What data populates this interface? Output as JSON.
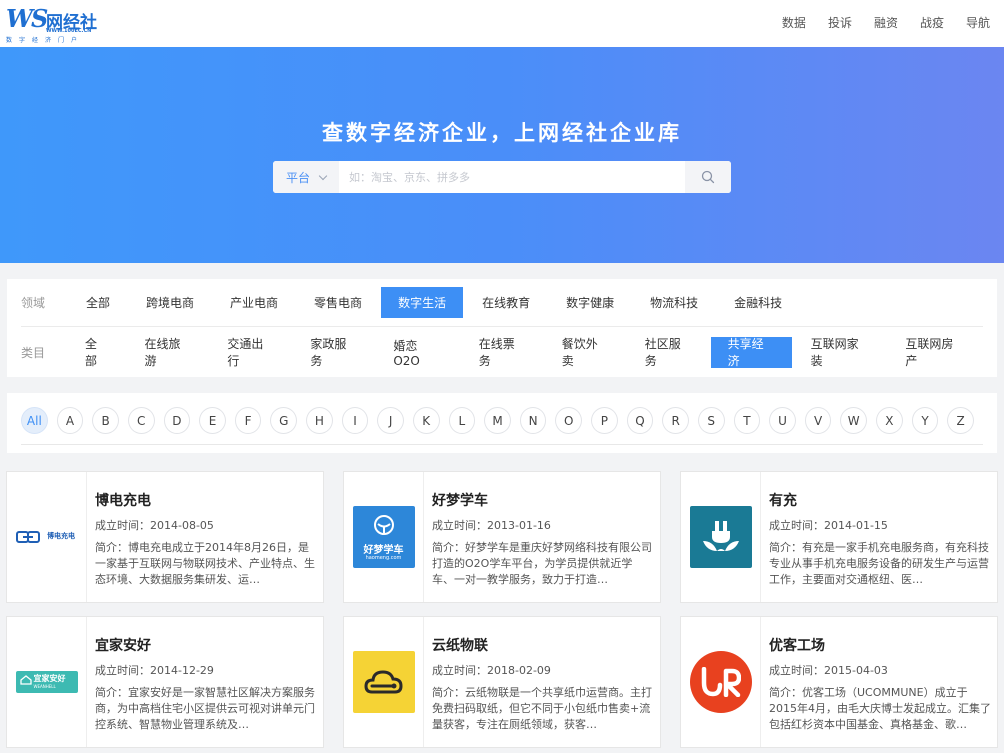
{
  "header": {
    "logo_mark": "WS",
    "logo_name": "网经社",
    "logo_url": "WWW.100EC.CN",
    "logo_tagline": "数字经济门户",
    "nav": [
      "数据",
      "投诉",
      "融资",
      "战疫",
      "导航"
    ]
  },
  "banner": {
    "title": "查数字经济企业，上网经社企业库",
    "search_category": "平台",
    "search_placeholder": "如：淘宝、京东、拼多多"
  },
  "filters": {
    "domain_label": "领域",
    "domains": [
      "全部",
      "跨境电商",
      "产业电商",
      "零售电商",
      "数字生活",
      "在线教育",
      "数字健康",
      "物流科技",
      "金融科技"
    ],
    "domain_active": 4,
    "category_label": "类目",
    "categories": [
      "全部",
      "在线旅游",
      "交通出行",
      "家政服务",
      "婚恋O2O",
      "在线票务",
      "餐饮外卖",
      "社区服务",
      "共享经济",
      "互联网家装",
      "互联网房产"
    ],
    "category_active": 8
  },
  "alphabet": {
    "letters": [
      "All",
      "A",
      "B",
      "C",
      "D",
      "E",
      "F",
      "G",
      "H",
      "I",
      "J",
      "K",
      "L",
      "M",
      "N",
      "O",
      "P",
      "Q",
      "R",
      "S",
      "T",
      "U",
      "V",
      "W",
      "X",
      "Y",
      "Z"
    ],
    "active": 0
  },
  "companies": [
    {
      "name": "博电充电",
      "founded": "成立时间：2014-08-05",
      "desc": "简介：博电充电成立于2014年8月26日，是一家基于互联网与物联网技术、产业特点、生态环境、大数据服务集研发、运…",
      "logo_text": "博电充电"
    },
    {
      "name": "好梦学车",
      "founded": "成立时间：2013-01-16",
      "desc": "简介：好梦学车是重庆好梦网络科技有限公司打造的O2O学车平台，为学员提供就近学车、一对一教学服务，致力于打造…",
      "logo_text": "好梦学车",
      "logo_sub": "haomeng.com"
    },
    {
      "name": "有充",
      "founded": "成立时间：2014-01-15",
      "desc": "简介：有充是一家手机充电服务商，有充科技专业从事手机充电服务设备的研发生产与运营工作，主要面对交通枢纽、医…"
    },
    {
      "name": "宜家安好",
      "founded": "成立时间：2014-12-29",
      "desc": "简介：宜家安好是一家智慧社区解决方案服务商，为中高档住宅小区提供云可视对讲单元门控系统、智慧物业管理系统及…",
      "logo_text": "宜家安好",
      "logo_sub": "WEANHELL"
    },
    {
      "name": "云纸物联",
      "founded": "成立时间：2018-02-09",
      "desc": "简介：云纸物联是一个共享纸巾运营商。主打免费扫码取纸，但它不同于小包纸巾售卖+流量获客，专注在厕纸领域，获客…"
    },
    {
      "name": "优客工场",
      "founded": "成立时间：2015-04-03",
      "desc": "简介：优客工场（UCOMMUNE）成立于2015年4月，由毛大庆博士发起成立。汇集了包括红杉资本中国基金、真格基金、歌…"
    }
  ],
  "colors": {
    "accent": "#3d8ff5",
    "banner_start": "#3f98fa",
    "banner_end": "#6b86f1",
    "youchong_bg": "#1a7a95",
    "yunzhi_bg": "#f5d335",
    "ucommune_bg": "#e8411f",
    "yijia_bg": "#3dbab2",
    "haomeng_bg": "#2d87d9"
  },
  "icons": {
    "search": "search-icon",
    "dropdown": "chevron-down-icon"
  }
}
